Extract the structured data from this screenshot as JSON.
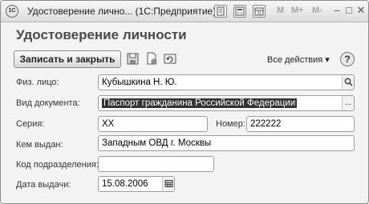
{
  "window": {
    "title": "Удостоверение лично... (1С:Предприятие)",
    "app_icon": "1С",
    "mem_buttons": [
      "M",
      "M+",
      "M-"
    ],
    "minimize": "–",
    "maximize": "□",
    "close": "✕"
  },
  "form": {
    "title": "Удостоверение личности",
    "save_close_label": "Записать и закрыть",
    "all_actions_label": "Все действия ▾",
    "help_label": "?"
  },
  "fields": {
    "person": {
      "label": "Физ. лицо:",
      "value": "Кубышкина Н. Ю."
    },
    "doc_type": {
      "label": "Вид документа:",
      "value": "Паспорт гражданина Российской Федерации",
      "button": "..."
    },
    "series": {
      "label": "Серия:",
      "value": "ХХ"
    },
    "number": {
      "label": "Номер:",
      "value": "222222"
    },
    "issued_by": {
      "label": "Кем выдан:",
      "value": "Западным ОВД г. Москвы"
    },
    "division_code": {
      "label": "Код подразделения:",
      "value": ""
    },
    "issue_date": {
      "label": "Дата выдачи:",
      "value": "15.08.2006"
    }
  }
}
